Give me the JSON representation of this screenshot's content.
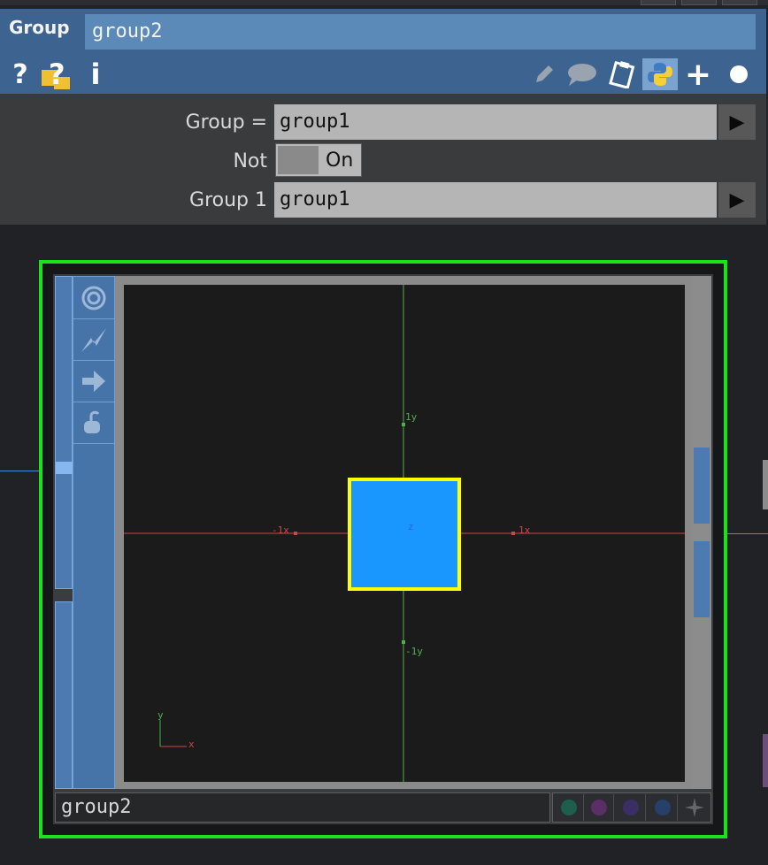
{
  "operator": {
    "type_label": "Group",
    "name": "group2"
  },
  "header_icons": [
    "help-icon",
    "python-help-icon",
    "info-icon",
    "edit-icon",
    "comment-icon",
    "clipboard-icon",
    "python-icon",
    "add-icon",
    "bypass-dot-icon"
  ],
  "header_glyphs": {
    "help": "?",
    "info": "i",
    "add": "+"
  },
  "params": {
    "group_expr": {
      "label": "Group =",
      "value": "group1",
      "arrow": "▶"
    },
    "not": {
      "label": "Not",
      "value": "On"
    },
    "group1": {
      "label": "Group 1",
      "value": "group1",
      "arrow": "▶"
    }
  },
  "viewer": {
    "axis_labels": {
      "pos_y": "1y",
      "neg_y": "-1y",
      "pos_x": "1x",
      "neg_x": "-1x",
      "z": "z"
    },
    "gizmo": {
      "x": "x",
      "y": "y"
    }
  },
  "node": {
    "label": "group2",
    "side_buttons": [
      "viewer-active-icon",
      "cook-icon",
      "export-arrow-icon",
      "lock-icon"
    ],
    "flags": [
      {
        "name": "flag-teal",
        "color": "#1f5d4d"
      },
      {
        "name": "flag-purple",
        "color": "#5a2f66"
      },
      {
        "name": "flag-violet",
        "color": "#3b2e64"
      },
      {
        "name": "flag-blue",
        "color": "#27406a"
      }
    ]
  },
  "colors": {
    "selection": "#19e319",
    "node_blue": "#4d7bb0",
    "highlight": "#ffff00",
    "geometry": "#1a96ff",
    "x_axis": "#c8484a",
    "y_axis": "#4faf4f"
  }
}
